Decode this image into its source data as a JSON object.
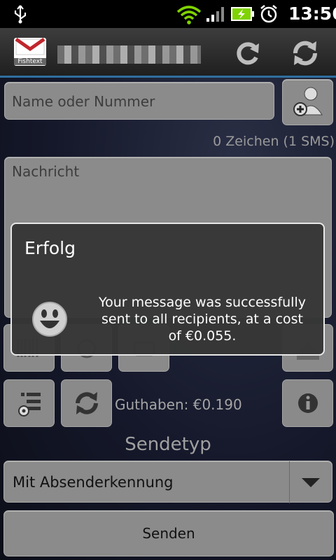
{
  "status_bar": {
    "time": "13:56",
    "icons": [
      "usb-icon",
      "wifi-icon",
      "signal-icon",
      "battery-charging-icon",
      "alarm-icon"
    ]
  },
  "title_bar": {
    "logo_text": "Fishtext",
    "account": "",
    "icons": [
      "sync-icon",
      "refresh-icon"
    ]
  },
  "compose": {
    "recipient_placeholder": "Name oder Nummer",
    "char_count": "0 Zeichen (1 SMS)",
    "message_placeholder": "Nachricht"
  },
  "toolbar": {
    "balance": "Guthaben: €0.190"
  },
  "send_type": {
    "heading": "Sendetyp",
    "selected": "Mit Absenderkennung"
  },
  "send_button": "Senden",
  "dialog": {
    "title": "Erfolg",
    "message": "Your message was successfully sent to all recipients, at a cost of €0.055."
  },
  "colors": {
    "accent": "#2f6f9f",
    "status_bar_bg": "#000000",
    "dialog_border": "#e8e8e8",
    "wifi": "#7fd300",
    "battery": "#7fd300"
  }
}
